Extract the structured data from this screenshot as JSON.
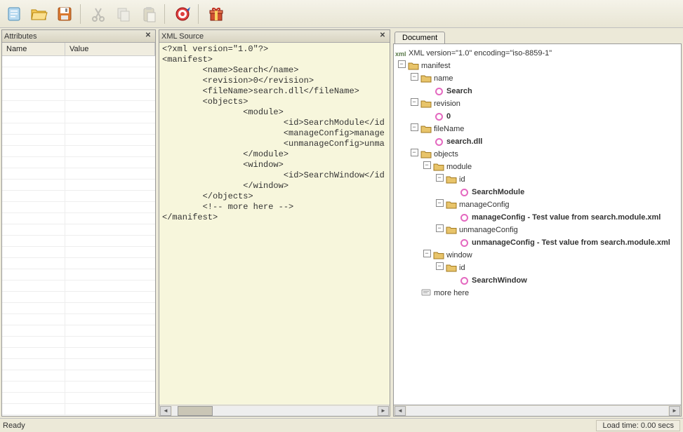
{
  "toolbar": {
    "icons": [
      "new-file",
      "open-folder",
      "save",
      "cut",
      "copy",
      "paste",
      "target",
      "gift"
    ]
  },
  "panels": {
    "attributes": {
      "title": "Attributes",
      "col_name": "Name",
      "col_value": "Value"
    },
    "xmlsource": {
      "title": "XML Source",
      "content": "<?xml version=\"1.0\"?>\n<manifest>\n        <name>Search</name>\n        <revision>0</revision>\n        <fileName>search.dll</fileName>\n        <objects>\n                <module>\n                        <id>SearchModule</id\n                        <manageConfig>manage\n                        <unmanageConfig>unma\n                </module>\n                <window>\n                        <id>SearchWindow</id\n                </window>\n        </objects>\n        <!-- more here -->\n</manifest>"
    },
    "document": {
      "tab": "Document",
      "xml_decl": "XML version=\"1.0\" encoding=\"iso-8859-1\"",
      "tree": [
        {
          "depth": 0,
          "toggle": "-",
          "icon": "folder",
          "label": "manifest"
        },
        {
          "depth": 1,
          "toggle": "-",
          "icon": "folder",
          "label": "name"
        },
        {
          "depth": 2,
          "toggle": "",
          "icon": "pink",
          "label": "Search",
          "bold": true
        },
        {
          "depth": 1,
          "toggle": "-",
          "icon": "folder",
          "label": "revision"
        },
        {
          "depth": 2,
          "toggle": "",
          "icon": "pink",
          "label": "0",
          "bold": true
        },
        {
          "depth": 1,
          "toggle": "-",
          "icon": "folder",
          "label": "fileName"
        },
        {
          "depth": 2,
          "toggle": "",
          "icon": "pink",
          "label": "search.dll",
          "bold": true
        },
        {
          "depth": 1,
          "toggle": "-",
          "icon": "folder",
          "label": "objects"
        },
        {
          "depth": 2,
          "toggle": "-",
          "icon": "folder",
          "label": "module"
        },
        {
          "depth": 3,
          "toggle": "-",
          "icon": "folder",
          "label": "id"
        },
        {
          "depth": 4,
          "toggle": "",
          "icon": "pink",
          "label": "SearchModule",
          "bold": true
        },
        {
          "depth": 3,
          "toggle": "-",
          "icon": "folder",
          "label": "manageConfig"
        },
        {
          "depth": 4,
          "toggle": "",
          "icon": "pink",
          "label": "manageConfig - Test value from search.module.xml",
          "bold": true
        },
        {
          "depth": 3,
          "toggle": "-",
          "icon": "folder",
          "label": "unmanageConfig"
        },
        {
          "depth": 4,
          "toggle": "",
          "icon": "pink",
          "label": "unmanageConfig - Test value from search.module.xml",
          "bold": true
        },
        {
          "depth": 2,
          "toggle": "-",
          "icon": "folder",
          "label": "window"
        },
        {
          "depth": 3,
          "toggle": "-",
          "icon": "folder",
          "label": "id"
        },
        {
          "depth": 4,
          "toggle": "",
          "icon": "pink",
          "label": "SearchWindow",
          "bold": true
        },
        {
          "depth": 1,
          "toggle": "",
          "icon": "comment",
          "label": "more here"
        }
      ]
    }
  },
  "status": {
    "ready": "Ready",
    "load": "Load time: 0.00 secs"
  }
}
